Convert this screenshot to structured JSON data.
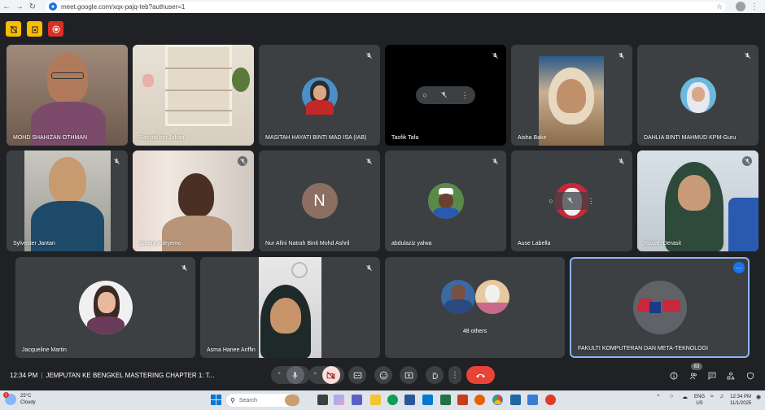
{
  "browser": {
    "url": "meet.google.com/xqx-pajq-teb?authuser=1"
  },
  "tiles": [
    {
      "name": "MOHD SHAHIZAN OTHMAN"
    },
    {
      "name": "Rasyidi bin Johari"
    },
    {
      "name": "MASITAH HAYATI BINTI MAD ISA (IAB)"
    },
    {
      "name": "Taofik Tafa"
    },
    {
      "name": "Aisha Bakir"
    },
    {
      "name": "DAHLIA BINTI MAHMUD KPM-Guru"
    },
    {
      "name": "Sylvester Jantan"
    },
    {
      "name": "Sarafa Adeyemo"
    },
    {
      "name": "Nur Afini Natrah Binti Mohd Ashril",
      "initial": "N"
    },
    {
      "name": "abdulaziz yalwa"
    },
    {
      "name": "Ause Labella"
    },
    {
      "name": "Roziah Derasit"
    },
    {
      "name": "Jacqueline Martin"
    },
    {
      "name": "Asma Hanee Ariffin"
    },
    {
      "name": "48 others"
    },
    {
      "name": "FAKULTI KOMPUTERAN DAN META-TEKNOLOGI"
    }
  ],
  "meeting": {
    "time": "12:34 PM",
    "title": "JEMPUTAN KE BENGKEL MASTERING CHAPTER 1: T...",
    "participants_count": "63"
  },
  "taskbar": {
    "weather_temp": "25°C",
    "weather_desc": "Cloudy",
    "weather_badge": "1",
    "search_placeholder": "Search",
    "lang_top": "ENG",
    "lang_bottom": "US",
    "clock_time": "12:34 PM",
    "clock_date": "11/1/2025"
  },
  "colors": {
    "tile_bg": "#3c4043",
    "end_call": "#ea4335",
    "active_border": "#8ab4f8",
    "page_bg": "#202124"
  }
}
